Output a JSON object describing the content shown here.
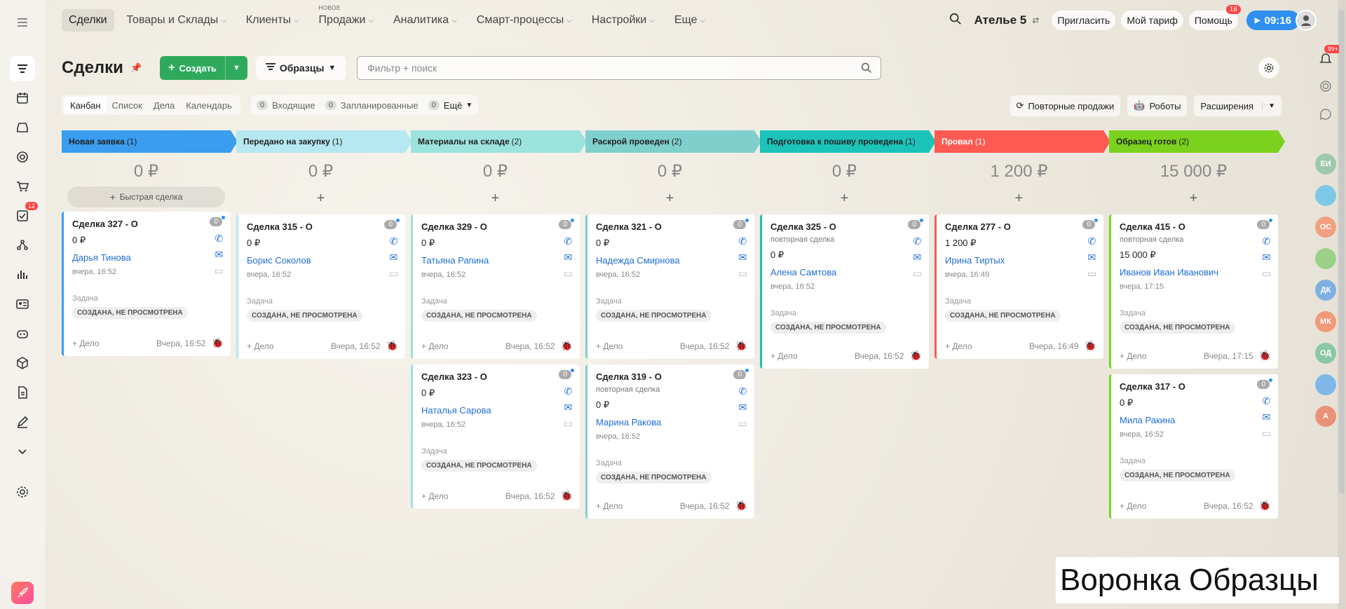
{
  "nav": {
    "items": [
      {
        "label": "Сделки",
        "active": true
      },
      {
        "label": "Товары и Склады",
        "chevron": true
      },
      {
        "label": "Клиенты",
        "chevron": true
      },
      {
        "label": "Продажи",
        "chevron": true,
        "badge": "НОВОЕ"
      },
      {
        "label": "Аналитика",
        "chevron": true
      },
      {
        "label": "Смарт-процессы",
        "chevron": true
      },
      {
        "label": "Настройки",
        "chevron": true
      },
      {
        "label": "Еще",
        "chevron": true
      }
    ]
  },
  "topright": {
    "company": "Ателье 5",
    "invite": "Пригласить",
    "tariff": "Мой тариф",
    "help": "Помощь",
    "help_badge": "18",
    "timer": "09:16"
  },
  "leftbar": {
    "tasks_badge": "12"
  },
  "rightbar": {
    "notif_badge": "99+",
    "avatars": [
      {
        "label": "ЕИ",
        "color": "#9fc7ae"
      },
      {
        "label": "",
        "color": "#7ec9e6"
      },
      {
        "label": "ОС",
        "color": "#f0a080"
      },
      {
        "label": "",
        "color": "#9bd08a"
      },
      {
        "label": "ДК",
        "color": "#7fb0e0"
      },
      {
        "label": "МК",
        "color": "#f09a7a"
      },
      {
        "label": "ОД",
        "color": "#8cc7a5"
      },
      {
        "label": "",
        "color": "#7fb8e8"
      },
      {
        "label": "А",
        "color": "#e9927a"
      }
    ]
  },
  "header": {
    "title": "Сделки",
    "create": "Создать",
    "funnel": "Образцы",
    "search_placeholder": "Фильтр + поиск"
  },
  "viewtabs": [
    "Канбан",
    "Список",
    "Дела",
    "Календарь"
  ],
  "counters": [
    {
      "count": "0",
      "label": "Входящие"
    },
    {
      "count": "0",
      "label": "Запланированные"
    },
    {
      "count": "0",
      "label": "Ещё"
    }
  ],
  "tools": {
    "repeat": "Повторные продажи",
    "robots": "Роботы",
    "ext": "Расширения"
  },
  "columns": [
    {
      "name": "Новая заявка",
      "count": "(1)",
      "color": "#3a9df0",
      "text": "#222",
      "sum": "0 ₽",
      "quick": "Быстрая сделка",
      "cards": [
        {
          "title": "Сделка 327 - О",
          "sub": "",
          "price": "0 ₽",
          "contact": "Дарья Тинова",
          "date": "вчера, 16:52",
          "task": "Задача",
          "status": "СОЗДАНА, НЕ ПРОСМОТРЕНА",
          "add": "+ Дело",
          "time": "Вчера, 16:52",
          "zero": "0"
        }
      ]
    },
    {
      "name": "Передано на закупку",
      "count": "(1)",
      "color": "#b6e8f2",
      "text": "#222",
      "sum": "0 ₽",
      "cards": [
        {
          "title": "Сделка 315 - О",
          "sub": "",
          "price": "0 ₽",
          "contact": "Борис Соколов",
          "date": "вчера, 16:52",
          "task": "Задача",
          "status": "СОЗДАНА, НЕ ПРОСМОТРЕНА",
          "add": "+ Дело",
          "time": "Вчера, 16:52",
          "zero": "0"
        }
      ]
    },
    {
      "name": "Материалы на складе",
      "count": "(2)",
      "color": "#9be3dc",
      "text": "#222",
      "sum": "0 ₽",
      "cards": [
        {
          "title": "Сделка 329 - О",
          "sub": "",
          "price": "0 ₽",
          "contact": "Татьяна Рапина",
          "date": "вчера, 16:52",
          "task": "Задача",
          "status": "СОЗДАНА, НЕ ПРОСМОТРЕНА",
          "add": "+ Дело",
          "time": "Вчера, 16:52",
          "zero": "0"
        },
        {
          "title": "Сделка 323 - О",
          "sub": "",
          "price": "0 ₽",
          "contact": "Наталья Сарова",
          "date": "вчера, 16:52",
          "task": "Задача",
          "status": "СОЗДАНА, НЕ ПРОСМОТРЕНА",
          "add": "+ Дело",
          "time": "Вчера, 16:52",
          "zero": "0"
        }
      ]
    },
    {
      "name": "Раскрой проведен",
      "count": "(2)",
      "color": "#7fd0cc",
      "text": "#222",
      "sum": "0 ₽",
      "cards": [
        {
          "title": "Сделка 321 - О",
          "sub": "",
          "price": "0 ₽",
          "contact": "Надежда Смирнова",
          "date": "вчера, 16:52",
          "task": "Задача",
          "status": "СОЗДАНА, НЕ ПРОСМОТРЕНА",
          "add": "+ Дело",
          "time": "Вчера, 16:52",
          "zero": "0"
        },
        {
          "title": "Сделка 319 - О",
          "sub": "повторная сделка",
          "price": "0 ₽",
          "contact": "Марина Ракова",
          "date": "вчера, 16:52",
          "task": "Задача",
          "status": "СОЗДАНА, НЕ ПРОСМОТРЕНА",
          "add": "+ Дело",
          "time": "Вчера, 16:52",
          "zero": "0"
        }
      ]
    },
    {
      "name": "Подготовка к пошиву проведена",
      "count": "(1)",
      "color": "#1cc3b8",
      "text": "#222",
      "sum": "0 ₽",
      "cards": [
        {
          "title": "Сделка 325 - О",
          "sub": "повторная сделка",
          "price": "0 ₽",
          "contact": "Алена Самтова",
          "date": "вчера, 16:52",
          "task": "Задача",
          "status": "СОЗДАНА, НЕ ПРОСМОТРЕНА",
          "add": "+ Дело",
          "time": "Вчера, 16:52",
          "zero": "0"
        }
      ]
    },
    {
      "name": "Провал",
      "count": "(1)",
      "color": "#ff5a52",
      "text": "#fff",
      "sum": "1 200 ₽",
      "cards": [
        {
          "title": "Сделка 277 - О",
          "sub": "",
          "price": "1 200 ₽",
          "contact": "Ирина Тиртых",
          "date": "вчера, 16:49",
          "task": "Задача",
          "status": "СОЗДАНА, НЕ ПРОСМОТРЕНА",
          "add": "+ Дело",
          "time": "Вчера, 16:49",
          "zero": "0"
        }
      ]
    },
    {
      "name": "Образец готов",
      "count": "(2)",
      "color": "#7ad21e",
      "text": "#222",
      "sum": "15 000 ₽",
      "cards": [
        {
          "title": "Сделка 415 - О",
          "sub": "повторная сделка",
          "price": "15 000 ₽",
          "contact": "Иванов Иван Иванович",
          "date": "вчера, 17:15",
          "task": "Задача",
          "status": "СОЗДАНА, НЕ ПРОСМОТРЕНА",
          "add": "+ Дело",
          "time": "Вчера, 17:15",
          "zero": "0"
        },
        {
          "title": "Сделка 317 - О",
          "sub": "",
          "price": "0 ₽",
          "contact": "Мила Ракина",
          "date": "вчера, 16:52",
          "task": "Задача",
          "status": "СОЗДАНА, НЕ ПРОСМОТРЕНА",
          "add": "+ Дело",
          "time": "Вчера, 16:52",
          "zero": "0"
        }
      ]
    }
  ],
  "watermark": "Воронка Образцы"
}
